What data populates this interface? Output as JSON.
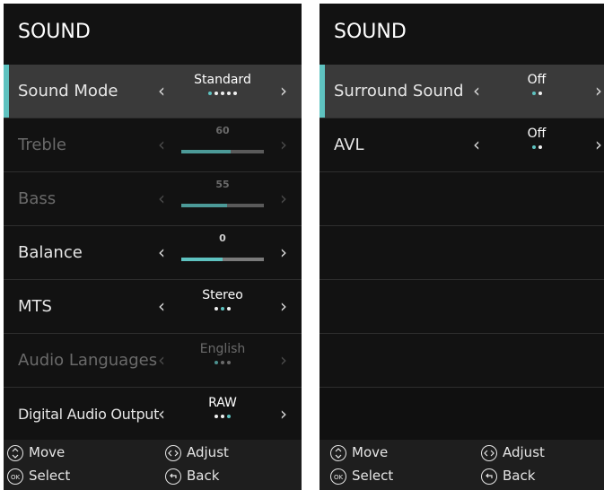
{
  "left": {
    "title": "SOUND",
    "rows": [
      {
        "label": "Sound Mode",
        "value": "Standard"
      },
      {
        "label": "Treble",
        "value": "60",
        "level": 0.6
      },
      {
        "label": "Bass",
        "value": "55",
        "level": 0.55
      },
      {
        "label": "Balance",
        "value": "0",
        "level": 0.5
      },
      {
        "label": "MTS",
        "value": "Stereo"
      },
      {
        "label": "Audio Languages",
        "value": "English"
      },
      {
        "label": "Digital Audio Output",
        "value": "RAW"
      }
    ],
    "footer": {
      "move": "Move",
      "adjust": "Adjust",
      "select": "Select",
      "back": "Back",
      "ok": "OK"
    }
  },
  "right": {
    "title": "SOUND",
    "rows": [
      {
        "label": "Surround Sound",
        "value": "Off"
      },
      {
        "label": "AVL",
        "value": "Off"
      }
    ],
    "footer": {
      "move": "Move",
      "adjust": "Adjust",
      "select": "Select",
      "back": "Back",
      "ok": "OK"
    }
  },
  "colors": {
    "accent": "#5ec2c0",
    "panel": "#121212",
    "focused_row": "#3a3a3a",
    "footer": "#1e1e1e"
  },
  "icons": {
    "arrow_left": "‹",
    "arrow_right": "›",
    "move": "updown-icon",
    "adjust": "leftright-icon",
    "select": "ok-icon",
    "back": "back-icon"
  }
}
